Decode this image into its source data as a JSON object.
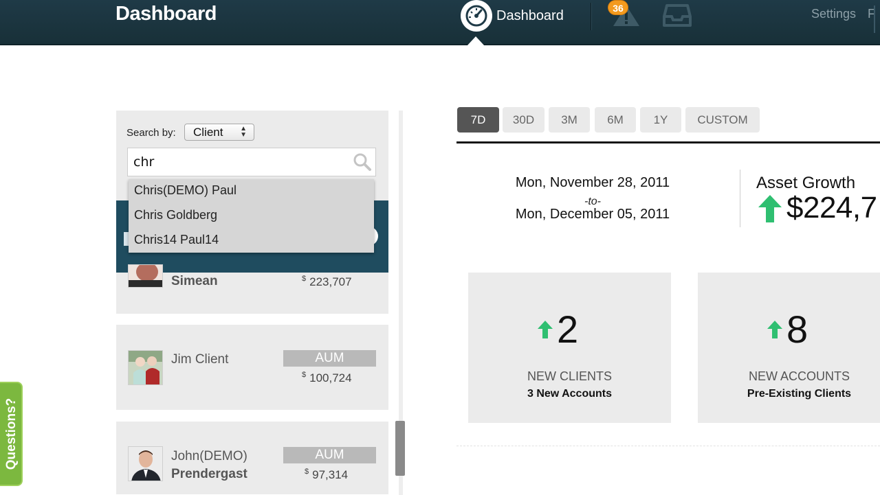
{
  "header": {
    "title": "Dashboard",
    "nav_dashboard_label": "Dashboard",
    "alerts_badge": "36",
    "settings_label": "Settings",
    "cut_label": "F"
  },
  "search": {
    "search_by_label": "Search by:",
    "select_value": "Client",
    "input_value": "chr",
    "suggestions": [
      "Chris(DEMO) Paul",
      "Chris Goldberg",
      "Chris14 Paul14"
    ]
  },
  "clients": [
    {
      "name_bold": "Simean",
      "aum_value": "223,707",
      "currency": "$"
    },
    {
      "name": "Jim Client",
      "aum_label": "AUM",
      "aum_value": "100,724",
      "currency": "$"
    },
    {
      "name": "John(DEMO)",
      "name_bold": "Prendergast",
      "aum_label": "AUM",
      "aum_value": "97,314",
      "currency": "$"
    }
  ],
  "questions_label": "Questions?",
  "ranges": {
    "selected": "7D",
    "items": [
      "7D",
      "30D",
      "3M",
      "6M",
      "1Y",
      "CUSTOM"
    ]
  },
  "period": {
    "from": "Mon, November 28, 2011",
    "to_label": "-to-",
    "to": "Mon, December 05, 2011"
  },
  "asset_growth": {
    "label": "Asset Growth",
    "value": "$224,7"
  },
  "stats": [
    {
      "number": "2",
      "title": "NEW CLIENTS",
      "subtitle": "3 New Accounts"
    },
    {
      "number": "8",
      "title": "NEW ACCOUNTS",
      "subtitle": "Pre-Existing Clients"
    }
  ],
  "colors": {
    "topbar": "#1f3a47",
    "accent_green": "#2fbf71",
    "badge_orange": "#f39a1e",
    "client_header": "#1f4c5f",
    "questions_tab": "#7cb83f"
  }
}
